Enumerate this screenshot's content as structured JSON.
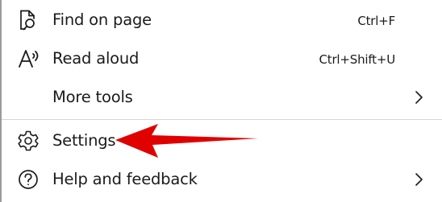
{
  "menu": {
    "find_on_page": {
      "label": "Find on page",
      "shortcut": "Ctrl+F",
      "icon": "find-on-page-icon"
    },
    "read_aloud": {
      "label": "Read aloud",
      "shortcut": "Ctrl+Shift+U",
      "icon": "read-aloud-icon"
    },
    "more_tools": {
      "label": "More tools",
      "icon": "chevron-right-icon"
    },
    "settings": {
      "label": "Settings",
      "icon": "gear-icon"
    },
    "help": {
      "label": "Help and feedback",
      "icon": "question-circle-icon"
    }
  },
  "annotation": {
    "arrow_color": "#e00000",
    "points_to": "settings"
  }
}
